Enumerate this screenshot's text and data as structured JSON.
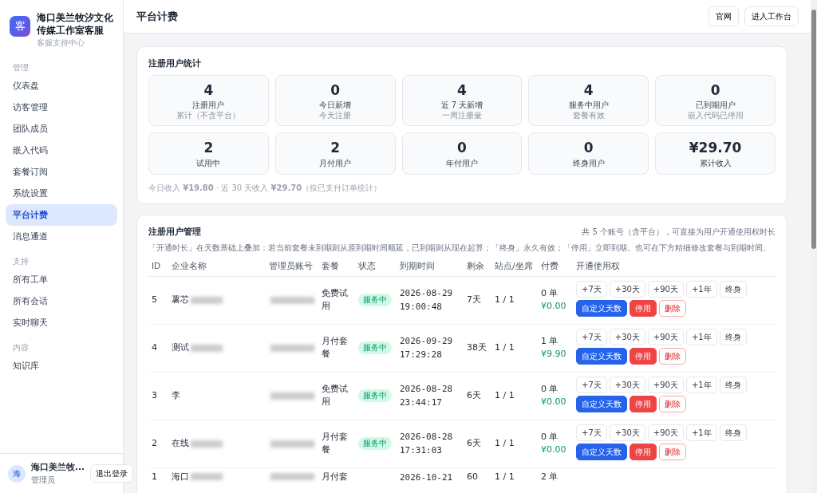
{
  "sidebar": {
    "logo": "客",
    "title": "海口美兰牧汐文化传媒工作室客服",
    "subtitle": "客服支持中心",
    "sections": [
      {
        "label": "管理",
        "items": [
          {
            "label": "仪表盘",
            "selected": false
          },
          {
            "label": "访客管理",
            "selected": false
          },
          {
            "label": "团队成员",
            "selected": false
          },
          {
            "label": "嵌入代码",
            "selected": false
          },
          {
            "label": "套餐订阅",
            "selected": false
          },
          {
            "label": "系统设置",
            "selected": false
          },
          {
            "label": "平台计费",
            "selected": true
          },
          {
            "label": "消息通道",
            "selected": false
          }
        ]
      },
      {
        "label": "支持",
        "items": [
          {
            "label": "所有工单",
            "selected": false
          },
          {
            "label": "所有会话",
            "selected": false
          },
          {
            "label": "实时聊天",
            "selected": false
          }
        ]
      },
      {
        "label": "内容",
        "items": [
          {
            "label": "知识库",
            "selected": false
          }
        ]
      }
    ],
    "user": {
      "avatar": "海",
      "name": "海口美兰牧...",
      "role": "管理员",
      "logout": "退出登录"
    }
  },
  "header": {
    "title": "平台计费",
    "buttons": [
      "官网",
      "进入工作台"
    ]
  },
  "stats": {
    "title": "注册用户统计",
    "cards": [
      {
        "value": "4",
        "label": "注册用户",
        "hint": "累计（不含平台）"
      },
      {
        "value": "0",
        "label": "今日新增",
        "hint": "今天注册"
      },
      {
        "value": "4",
        "label": "近 7 天新增",
        "hint": "一周注册量"
      },
      {
        "value": "4",
        "label": "服务中用户",
        "hint": "套餐有效"
      },
      {
        "value": "0",
        "label": "已到期用户",
        "hint": "嵌入代码已停用"
      },
      {
        "value": "2",
        "label": "试用中"
      },
      {
        "value": "2",
        "label": "月付用户"
      },
      {
        "value": "0",
        "label": "年付用户"
      },
      {
        "value": "0",
        "label": "终身用户"
      },
      {
        "value": "¥29.70",
        "label": "累计收入"
      }
    ],
    "footnote": "今日收入 **¥19.80** · 近 30 天收入 **¥29.70**（按已支付订单统计）"
  },
  "management": {
    "title": "注册用户管理",
    "summary": "共 5 个账号（含平台），可直接为用户开通使用权时长",
    "note": "「开通时长」在天数基础上叠加：若当前套餐未到期则从原到期时间顺延，已到期则从现在起算；「终身」永久有效；「停用」立即到期。也可在下方精细修改套餐与到期时间。",
    "columns": [
      "ID",
      "企业名称",
      "管理员账号",
      "套餐",
      "状态",
      "到期时间",
      "剩余",
      "站点/坐席",
      "付费",
      "开通使用权"
    ],
    "rows": [
      {
        "id": "5",
        "name": "薯芯",
        "name_blurred": true,
        "admin_blurred": true,
        "plan": "免费试用",
        "status": "服务中",
        "expiry_date": "2026-08-29",
        "expiry_time": "19:00:48",
        "remaining": "7天",
        "seats": "1 / 1",
        "orders": "0 单",
        "amount": "¥0.00",
        "quick_actions": [
          "+7天",
          "+30天",
          "+90天",
          "+1年",
          "终身"
        ],
        "actions": [
          {
            "label": "自定义天数",
            "kind": "primary"
          },
          {
            "label": "停用",
            "kind": "danger"
          },
          {
            "label": "删除",
            "kind": "outline-danger"
          }
        ]
      },
      {
        "id": "4",
        "name": "测试",
        "name_blurred": true,
        "admin_blurred": true,
        "plan": "月付套餐",
        "status": "服务中",
        "expiry_date": "2026-09-29",
        "expiry_time": "17:29:28",
        "remaining": "38天",
        "seats": "1 / 1",
        "orders": "1 单",
        "amount": "¥9.90",
        "quick_actions": [
          "+7天",
          "+30天",
          "+90天",
          "+1年",
          "终身"
        ],
        "actions": [
          {
            "label": "自定义天数",
            "kind": "primary"
          },
          {
            "label": "停用",
            "kind": "danger"
          },
          {
            "label": "删除",
            "kind": "outline-danger"
          }
        ]
      },
      {
        "id": "3",
        "name": "李",
        "name_blurred": false,
        "admin_blurred": true,
        "plan": "免费试用",
        "status": "服务中",
        "expiry_date": "2026-08-28",
        "expiry_time": "23:44:17",
        "remaining": "6天",
        "seats": "1 / 1",
        "orders": "0 单",
        "amount": "¥0.00",
        "quick_actions": [
          "+7天",
          "+30天",
          "+90天",
          "+1年",
          "终身"
        ],
        "actions": [
          {
            "label": "自定义天数",
            "kind": "primary"
          },
          {
            "label": "停用",
            "kind": "danger"
          },
          {
            "label": "删除",
            "kind": "outline-danger"
          }
        ]
      },
      {
        "id": "2",
        "name": "在线",
        "name_blurred": true,
        "admin_blurred": true,
        "plan": "月付套餐",
        "status": "服务中",
        "expiry_date": "2026-08-28",
        "expiry_time": "17:31:03",
        "remaining": "6天",
        "seats": "1 / 1",
        "orders": "0 单",
        "amount": "¥0.00",
        "quick_actions": [
          "+7天",
          "+30天",
          "+90天",
          "+1年",
          "终身"
        ],
        "actions": [
          {
            "label": "自定义天数",
            "kind": "primary"
          },
          {
            "label": "停用",
            "kind": "danger"
          },
          {
            "label": "删除",
            "kind": "outline-danger"
          }
        ]
      },
      {
        "id": "1",
        "name": "海口",
        "name_blurred": true,
        "admin_blurred": true,
        "plan": "月付套",
        "expiry_date": "2026-10-21",
        "remaining": "60",
        "seats": "1 / 1",
        "orders": "2 单"
      }
    ]
  }
}
